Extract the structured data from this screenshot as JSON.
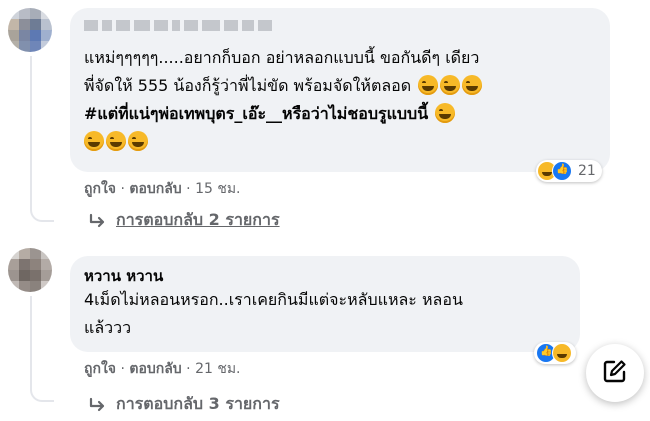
{
  "comments": [
    {
      "author": "",
      "lines": [
        "แหม่ๆๆๆๆๆ.....อยากก็บอก อย่าหลอกแบบนี้ ขอกันดีๆ เดียว",
        "พี่จัดให้ 555 น้องก็รู้ว่าพี่ไม่ขัด พร้อมจัดให้ตลอด"
      ],
      "hashtag": "#แต่ที่แน่ๆพ่อเทพบุตร_เอ๊ะ__หรือว่าไม่ชอบรูแบบนี้",
      "like_label": "ถูกใจ",
      "reply_label": "ตอบกลับ",
      "separator": "·",
      "time": "15 ชม.",
      "reaction_count": "21",
      "replies_label": "การตอบกลับ 2 รายการ",
      "reaction_icons": [
        "haha",
        "like"
      ]
    },
    {
      "author": "หวาน หวาน",
      "lines": [
        "4เม็ดไม่หลอนหรอก..เราเคยกินมีแต่จะหลับแหละ หลอน",
        "แล้ววว"
      ],
      "like_label": "ถูกใจ",
      "reply_label": "ตอบกลับ",
      "separator": "·",
      "time": "21 ชม.",
      "replies_label": "การตอบกลับ 3 รายการ",
      "reaction_icons": [
        "like",
        "haha"
      ]
    }
  ],
  "fab": {
    "icon": "compose-icon"
  },
  "colors": {
    "bubble": "#f0f2f5",
    "meta": "#65676b",
    "like_blue": "#1877f2",
    "haha_yellow": "#f7b928"
  }
}
